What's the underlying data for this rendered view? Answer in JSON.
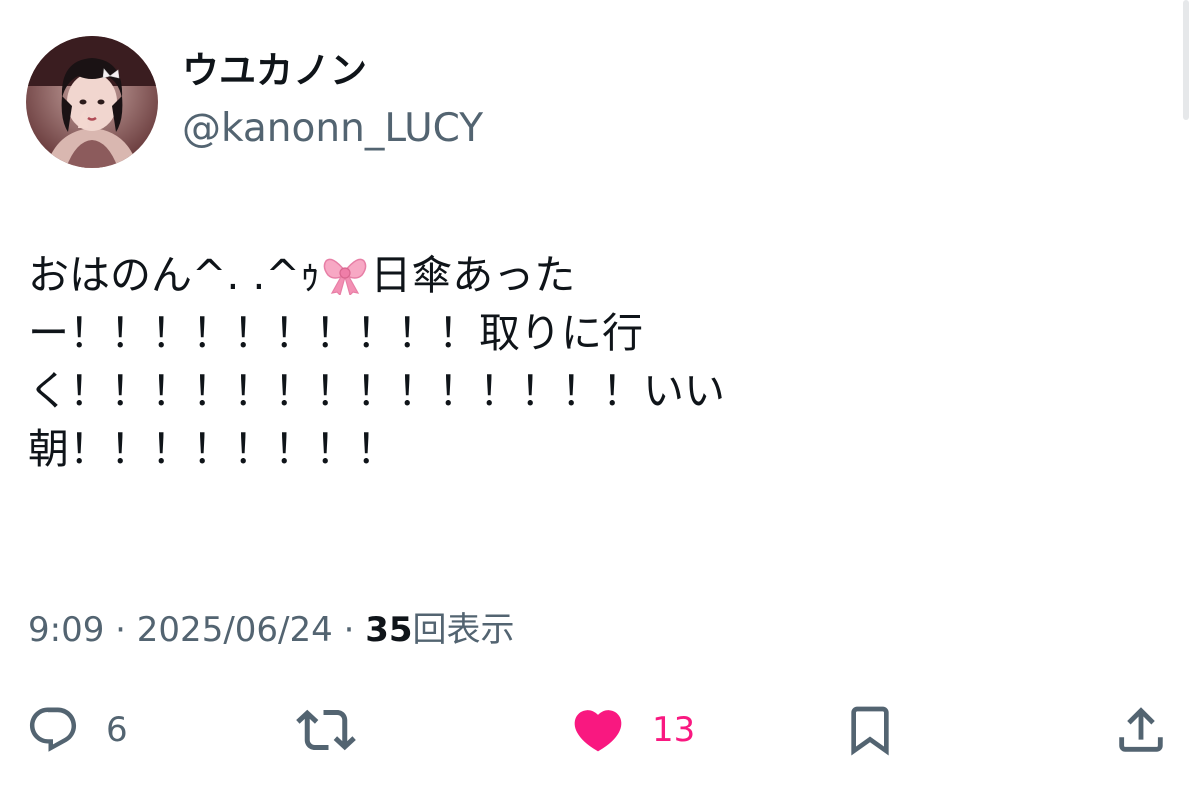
{
  "author": {
    "display_name": "ウユカノン",
    "handle": "@kanonn_LUCY"
  },
  "tweet": {
    "lines": [
      {
        "before": "おはのん^. .^ｩ",
        "after": "日傘あった"
      },
      {
        "text": "ー！！！！！！！！！！取りに行"
      },
      {
        "text": "く！！！！！！！！！！！！！！いい"
      },
      {
        "text": "朝！！！！！！！！"
      }
    ],
    "emoji": "ribbon-bow"
  },
  "meta": {
    "time": "9:09",
    "separator": " · ",
    "date": "2025/06/24",
    "views_count": "35",
    "views_label": "回表示"
  },
  "actions": {
    "reply_count": "6",
    "like_count": "13"
  },
  "colors": {
    "text": "#0f1419",
    "secondary": "#536471",
    "like": "#f91880"
  }
}
